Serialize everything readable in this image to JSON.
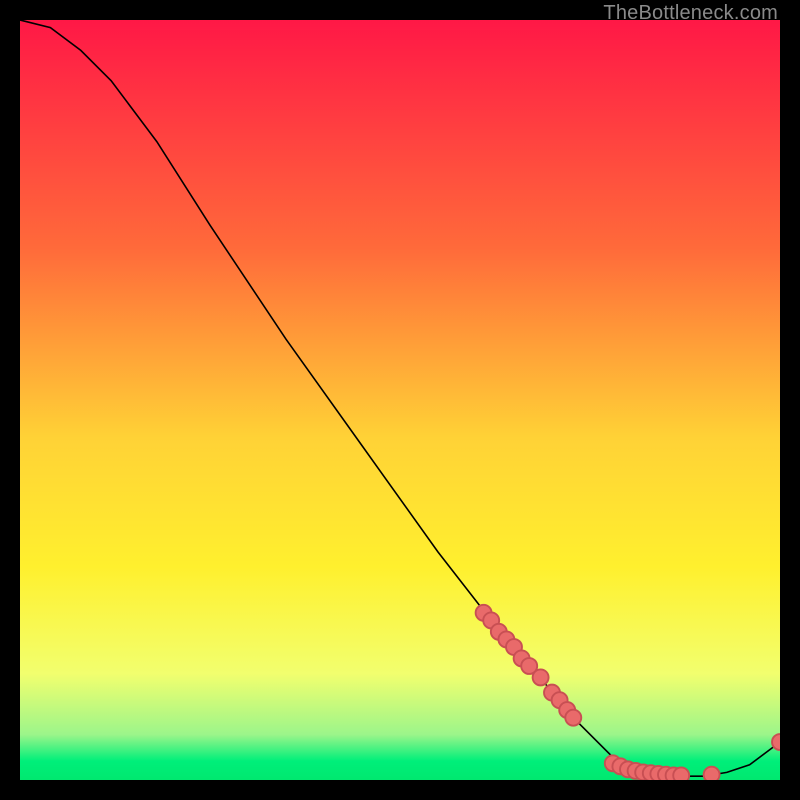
{
  "watermark": "TheBottleneck.com",
  "colors": {
    "bg": "#000000",
    "grad_top": "#ff1846",
    "grad_mid1": "#ff6a3a",
    "grad_mid2": "#ffd236",
    "grad_mid3": "#fff02e",
    "grad_low": "#f2ff6e",
    "grad_green": "#00ef7a",
    "curve": "#000000",
    "marker_fill": "#e96a6a",
    "marker_stroke": "#c84f53"
  },
  "chart_data": {
    "type": "line",
    "title": "",
    "xlabel": "",
    "ylabel": "",
    "xlim": [
      0,
      100
    ],
    "ylim": [
      0,
      100
    ],
    "curve": [
      {
        "x": 0,
        "y": 100
      },
      {
        "x": 4,
        "y": 99
      },
      {
        "x": 8,
        "y": 96
      },
      {
        "x": 12,
        "y": 92
      },
      {
        "x": 18,
        "y": 84
      },
      {
        "x": 25,
        "y": 73
      },
      {
        "x": 35,
        "y": 58
      },
      {
        "x": 45,
        "y": 44
      },
      {
        "x": 55,
        "y": 30
      },
      {
        "x": 62,
        "y": 21
      },
      {
        "x": 68,
        "y": 14
      },
      {
        "x": 73,
        "y": 8
      },
      {
        "x": 78,
        "y": 3
      },
      {
        "x": 82,
        "y": 1
      },
      {
        "x": 86,
        "y": 0.5
      },
      {
        "x": 90,
        "y": 0.5
      },
      {
        "x": 93,
        "y": 1
      },
      {
        "x": 96,
        "y": 2
      },
      {
        "x": 100,
        "y": 5
      }
    ],
    "markers": [
      {
        "x": 61,
        "y": 22
      },
      {
        "x": 62,
        "y": 21
      },
      {
        "x": 63,
        "y": 19.5
      },
      {
        "x": 64,
        "y": 18.5
      },
      {
        "x": 65,
        "y": 17.5
      },
      {
        "x": 66,
        "y": 16
      },
      {
        "x": 67,
        "y": 15
      },
      {
        "x": 68.5,
        "y": 13.5
      },
      {
        "x": 70,
        "y": 11.5
      },
      {
        "x": 71,
        "y": 10.5
      },
      {
        "x": 72,
        "y": 9.2
      },
      {
        "x": 72.8,
        "y": 8.2
      },
      {
        "x": 78,
        "y": 2.2
      },
      {
        "x": 79,
        "y": 1.8
      },
      {
        "x": 80,
        "y": 1.4
      },
      {
        "x": 81,
        "y": 1.2
      },
      {
        "x": 82,
        "y": 1.0
      },
      {
        "x": 83,
        "y": 0.9
      },
      {
        "x": 84,
        "y": 0.8
      },
      {
        "x": 85,
        "y": 0.7
      },
      {
        "x": 86,
        "y": 0.6
      },
      {
        "x": 87,
        "y": 0.6
      },
      {
        "x": 91,
        "y": 0.7
      },
      {
        "x": 100,
        "y": 5
      }
    ],
    "gradient_stops": [
      {
        "offset": 0,
        "color": "#ff1846"
      },
      {
        "offset": 0.3,
        "color": "#ff6a3a"
      },
      {
        "offset": 0.55,
        "color": "#ffd236"
      },
      {
        "offset": 0.72,
        "color": "#fff02e"
      },
      {
        "offset": 0.86,
        "color": "#f2ff6e"
      },
      {
        "offset": 0.94,
        "color": "#9cf58a"
      },
      {
        "offset": 0.975,
        "color": "#00ef7a"
      },
      {
        "offset": 1.0,
        "color": "#00e86f"
      }
    ]
  }
}
